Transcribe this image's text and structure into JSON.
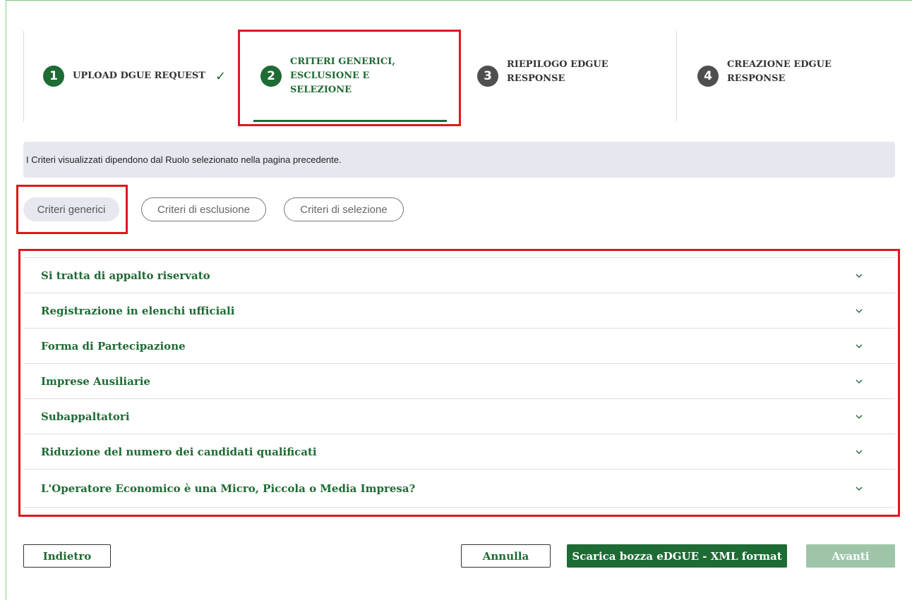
{
  "stepper": {
    "steps": [
      {
        "number": "1",
        "label": "UPLOAD DGUE REQUEST",
        "status": "completed"
      },
      {
        "number": "2",
        "label_lines": [
          "CRITERI GENERICI,",
          "ESCLUSIONE E",
          "SELEZIONE"
        ],
        "status": "active"
      },
      {
        "number": "3",
        "label_lines": [
          "RIEPILOGO EDGUE",
          "RESPONSE"
        ],
        "status": "pending"
      },
      {
        "number": "4",
        "label_lines": [
          "CREAZIONE EDGUE",
          "RESPONSE"
        ],
        "status": "pending"
      }
    ],
    "check_icon": "checkmark-icon"
  },
  "info_text": "I Criteri visualizzati dipendono dal Ruolo selezionato nella pagina precedente.",
  "filters": [
    {
      "label": "Criteri generici",
      "selected": true
    },
    {
      "label": "Criteri di esclusione",
      "selected": false
    },
    {
      "label": "Criteri di selezione",
      "selected": false
    }
  ],
  "accordion": [
    {
      "title": "Si tratta di appalto riservato"
    },
    {
      "title": "Registrazione in elenchi ufficiali"
    },
    {
      "title": "Forma di Partecipazione"
    },
    {
      "title": "Imprese Ausiliarie"
    },
    {
      "title": "Subappaltatori"
    },
    {
      "title": "Riduzione del numero dei candidati qualificati"
    },
    {
      "title": "L'Operatore Economico è una Micro, Piccola o Media Impresa?"
    }
  ],
  "buttons": {
    "back": "Indietro",
    "cancel": "Annulla",
    "download": "Scarica bozza eDGUE - XML format",
    "next": "Avanti"
  },
  "colors": {
    "primary_green": "#1e6b34",
    "highlight_red": "#e0161e",
    "info_bg": "#e6e8ef",
    "disabled_green": "#9fc5a8"
  }
}
